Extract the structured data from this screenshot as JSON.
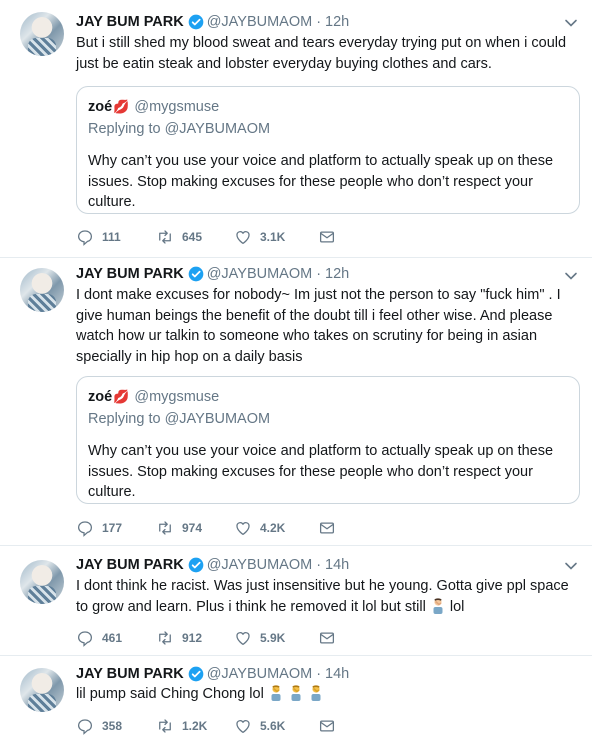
{
  "tweets": [
    {
      "name": "JAY BUM PARK",
      "handle": "@JAYBUMAOM",
      "separator": "·",
      "time": "12h",
      "text": "But i still shed my blood sweat and tears everyday trying put on when i could just be eatin steak and lobster everyday buying clothes and cars.",
      "quote": {
        "name": "zoé",
        "handle": "@mygsmuse",
        "reply_prefix": "Replying to",
        "reply_handle": "@JAYBUMAOM",
        "text": "Why can’t you use your voice and platform to actually speak up on these issues. Stop making excuses for these people who don’t respect your culture."
      },
      "replies": "111",
      "retweets": "645",
      "likes": "3.1K"
    },
    {
      "name": "JAY BUM PARK",
      "handle": "@JAYBUMAOM",
      "separator": "·",
      "time": "12h",
      "text": "I dont make excuses for nobody~ Im just not the person to say \"fuck him\" . I give human beings the benefit of the doubt till i feel other wise.  And please watch how ur talkin to someone who takes on scrutiny for being in asian specially in hip hop on a daily basis",
      "quote": {
        "name": "zoé",
        "handle": "@mygsmuse",
        "reply_prefix": "Replying to",
        "reply_handle": "@JAYBUMAOM",
        "text": "Why can’t you use your voice and platform to actually speak up on these issues. Stop making excuses for these people who don’t respect your culture."
      },
      "replies": "177",
      "retweets": "974",
      "likes": "4.2K"
    },
    {
      "name": "JAY BUM PARK",
      "handle": "@JAYBUMAOM",
      "separator": "·",
      "time": "14h",
      "text": "I dont think he racist. Was just insensitive but he young. Gotta give ppl space to grow and learn. Plus i think he removed it lol  but still",
      "text_end": "lol",
      "replies": "461",
      "retweets": "912",
      "likes": "5.9K"
    },
    {
      "name": "JAY BUM PARK",
      "handle": "@JAYBUMAOM",
      "separator": "·",
      "time": "14h",
      "text": "lil pump said Ching Chong lol",
      "replies": "358",
      "retweets": "1.2K",
      "likes": "5.6K"
    }
  ],
  "colors": {
    "verified_blue": "#1da1f2",
    "muted": "#657786",
    "border": "#e6ecf0"
  },
  "icons": [
    "verified-badge-icon",
    "chevron-down-icon",
    "reply-icon",
    "retweet-icon",
    "like-icon",
    "direct-message-icon",
    "facepalm-emoji-icon",
    "kiss-lips-icon"
  ]
}
